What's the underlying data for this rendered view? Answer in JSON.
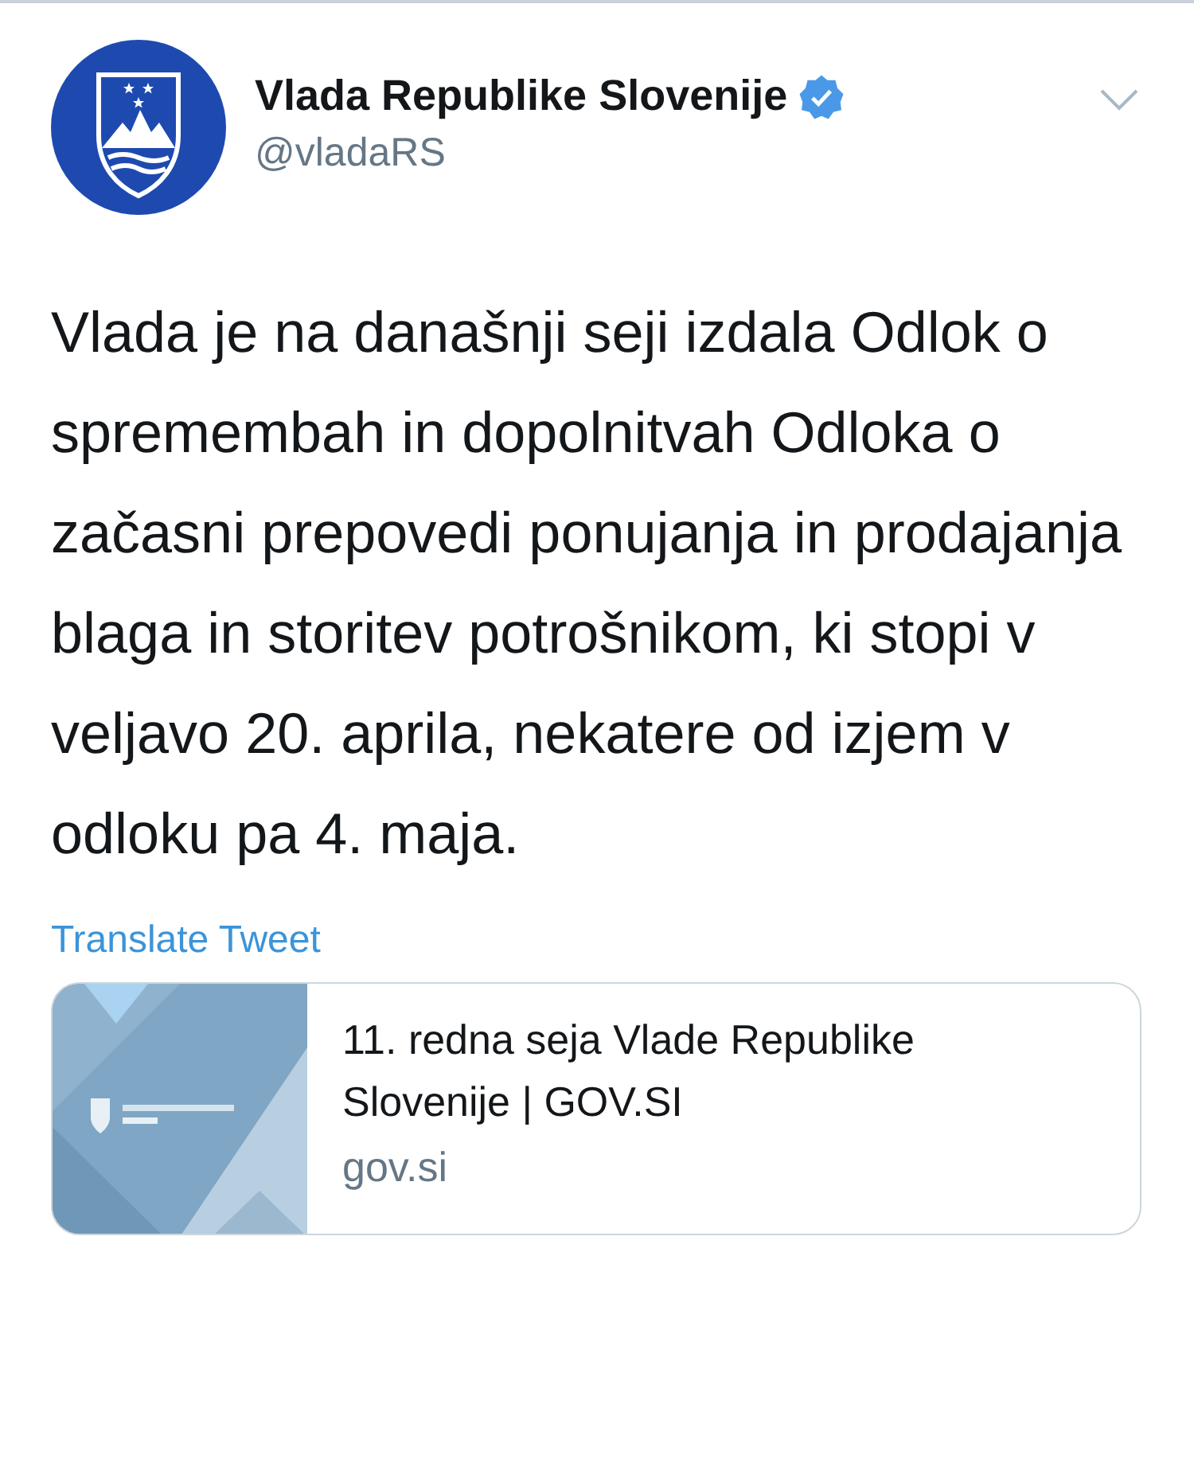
{
  "account": {
    "name": "Vlada Republike Slovenije",
    "handle": "@vladaRS",
    "verified": true
  },
  "tweet": {
    "text": "Vlada je na današnji seji izdala Odlok o spremembah in dopolnitvah Odloka o začasni prepovedi ponujanja in prodajanja blaga in storitev potrošnikom, ki stopi v veljavo 20. aprila, nekatere od izjem v odloku pa 4. maja.",
    "translate": "Translate Tweet"
  },
  "link_card": {
    "title": "11. redna seja Vlade Republike Slovenije | GOV.SI",
    "domain": "gov.si"
  }
}
